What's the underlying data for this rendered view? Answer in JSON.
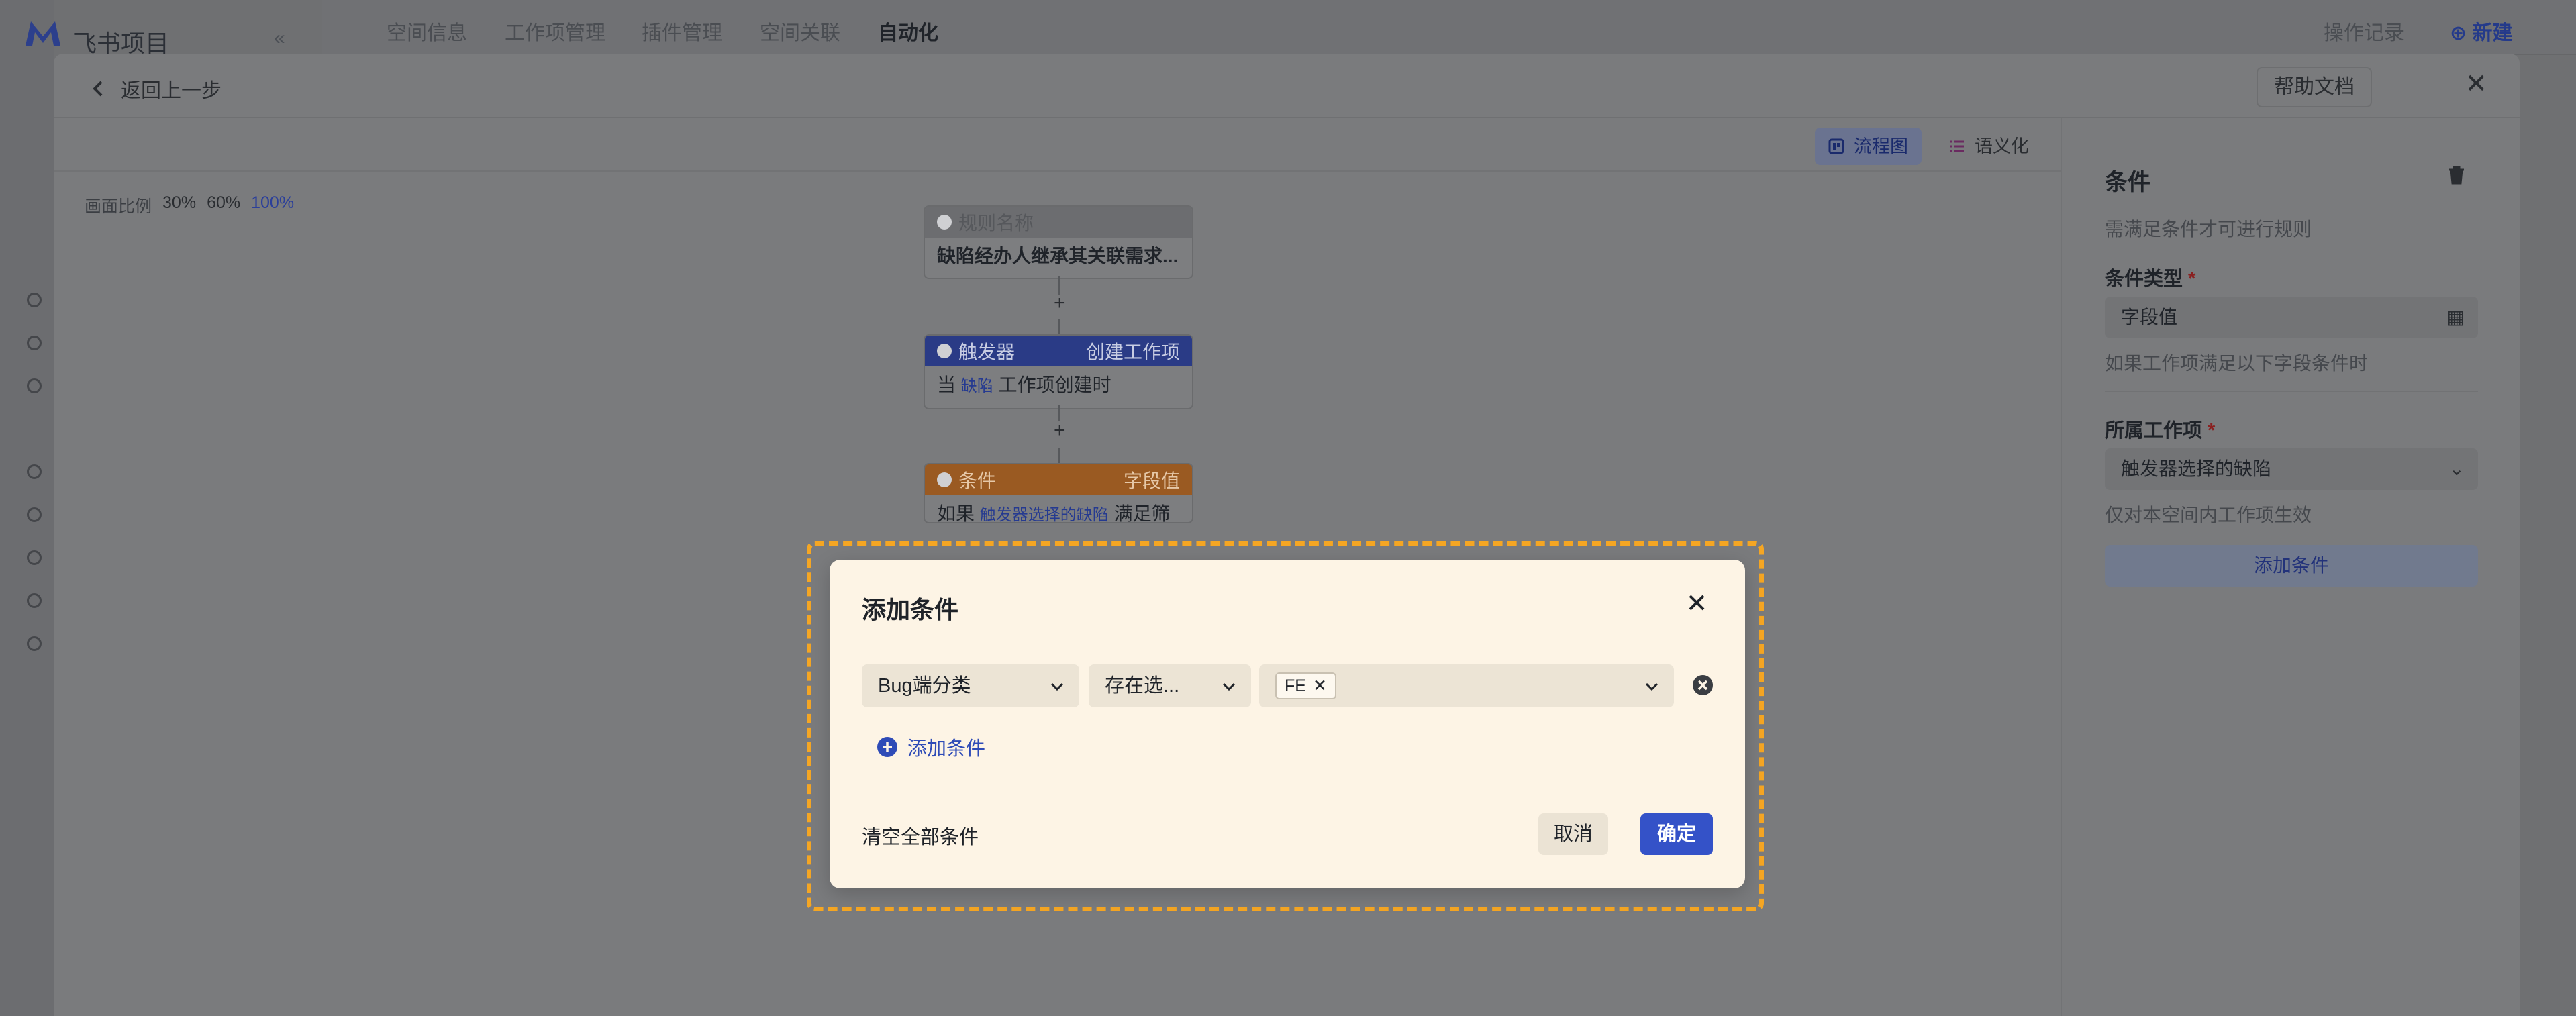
{
  "app": {
    "name": "飞书项目",
    "logo_icon": "feishu-project-logo",
    "collapse_glyph": "«"
  },
  "topnav": {
    "tabs": [
      "空间信息",
      "工作项管理",
      "插件管理",
      "空间关联",
      "自动化"
    ],
    "active_tab": "自动化",
    "history": "操作记录",
    "new_label": "新建"
  },
  "panel": {
    "back_label": "返回上一步",
    "help_label": "帮助文档",
    "views": [
      {
        "label": "流程图",
        "icon": "flowchart-icon",
        "active": true
      },
      {
        "label": "语义化",
        "icon": "list-icon",
        "active": false
      }
    ],
    "zoom": {
      "label": "画面比例",
      "options": [
        "30%",
        "60%",
        "100%"
      ],
      "active": "100%"
    }
  },
  "flow": {
    "rule": {
      "head": "规则名称",
      "body": "缺陷经办人继承其关联需求..."
    },
    "trigger": {
      "head": "触发器",
      "tag": "创建工作项",
      "body_pre": "当",
      "body_kw": "缺陷",
      "body_post": "工作项创建时"
    },
    "condition": {
      "head": "条件",
      "tag": "字段值",
      "body_pre": "如果",
      "body_kw": "触发器选择的缺陷",
      "body_post": "满足筛选条件"
    },
    "plus": "+"
  },
  "right_panel": {
    "title": "条件",
    "desc": "需满足条件才可进行规则",
    "type_label": "条件类型",
    "required_mark": "*",
    "type_value": "字段值",
    "type_hint": "如果工作项满足以下字段条件时",
    "item_label": "所属工作项",
    "item_value": "触发器选择的缺陷",
    "item_hint": "仅对本空间内工作项生效",
    "add_label": "添加条件"
  },
  "modal": {
    "title": "添加条件",
    "field_select": "Bug端分类",
    "operator_select": "存在选...",
    "value_tags": [
      "FE"
    ],
    "add_condition": "添加条件",
    "clear_all": "清空全部条件",
    "cancel": "取消",
    "confirm": "确定"
  },
  "colors": {
    "highlight": "#f5a623",
    "primary": "#3452c8",
    "modal_bg": "#fdf4e5"
  }
}
